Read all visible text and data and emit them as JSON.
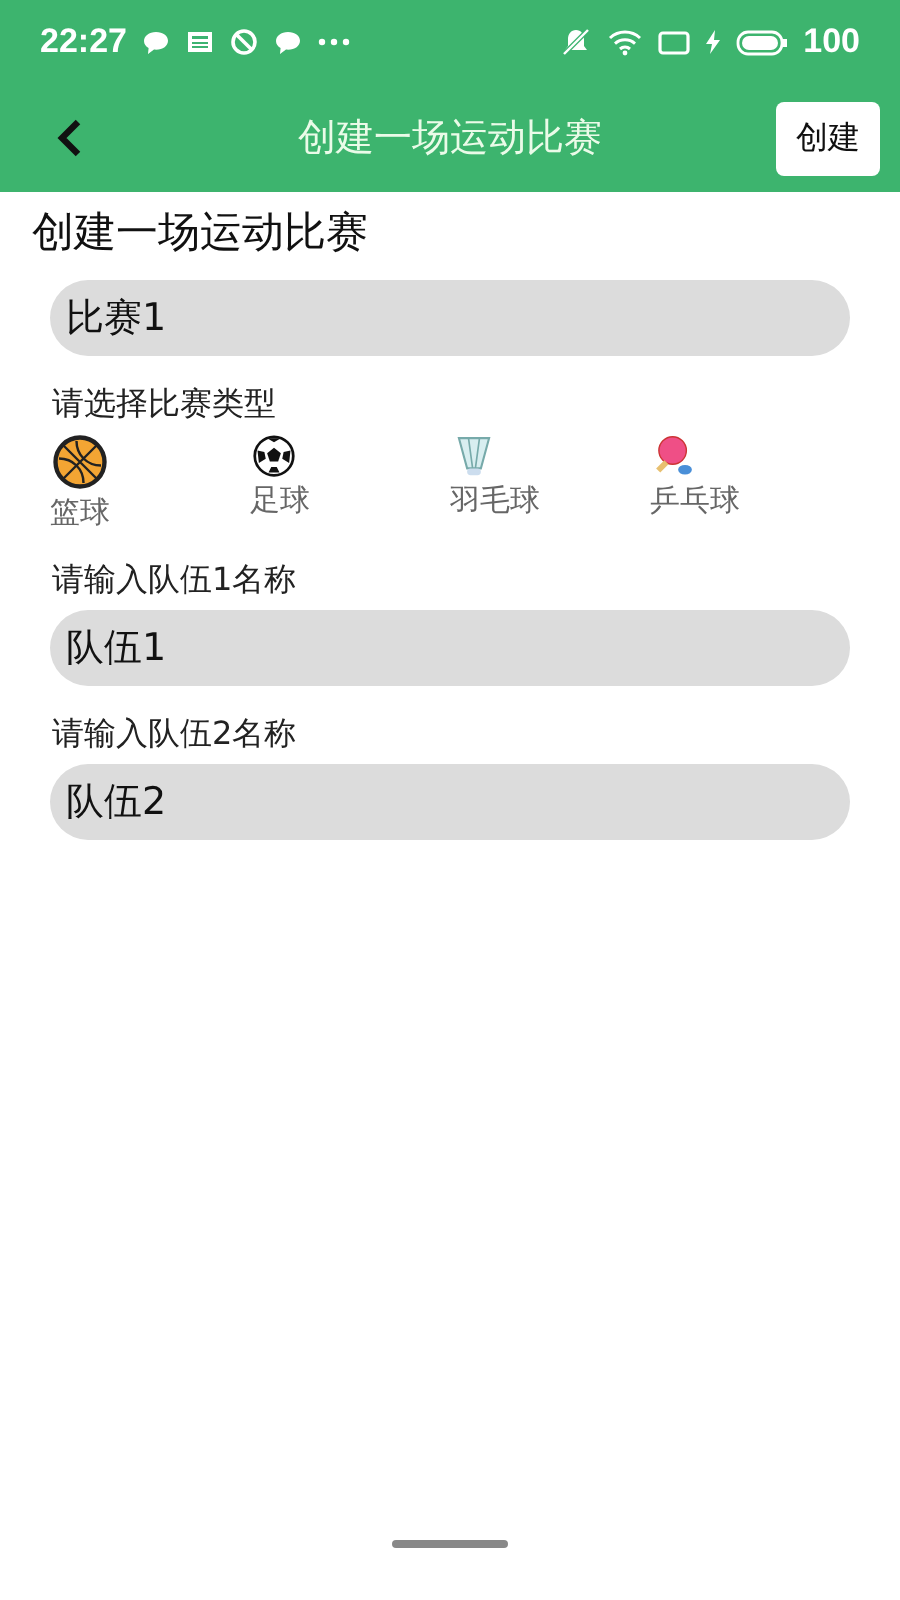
{
  "status_bar": {
    "time": "22:27",
    "battery": "100"
  },
  "toolbar": {
    "title": "创建一场运动比赛",
    "action": "创建"
  },
  "heading": "创建一场运动比赛",
  "name_field": {
    "value": "比赛1"
  },
  "type_label": "请选择比赛类型",
  "sports": [
    {
      "kind": "basketball",
      "label": "篮球",
      "selected": true
    },
    {
      "kind": "football",
      "label": "足球",
      "selected": false
    },
    {
      "kind": "badminton",
      "label": "羽毛球",
      "selected": false
    },
    {
      "kind": "pingpong",
      "label": "乒乓球",
      "selected": false
    }
  ],
  "teams": [
    {
      "label": "请输入队伍1名称",
      "value": "队伍1"
    },
    {
      "label": "请输入队伍2名称",
      "value": "队伍2"
    }
  ]
}
